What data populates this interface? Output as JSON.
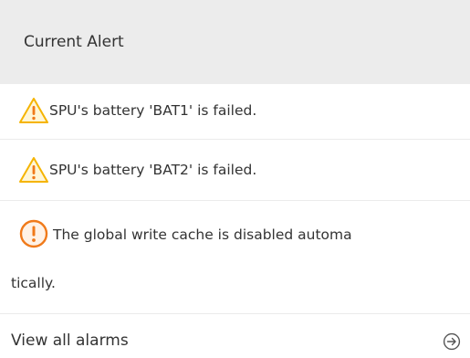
{
  "panel": {
    "title": "Current Alert"
  },
  "alerts": [
    {
      "severity": "warning",
      "icon": "warning-triangle-icon",
      "message": "SPU's battery 'BAT1' is failed."
    },
    {
      "severity": "warning",
      "icon": "warning-triangle-icon",
      "message": "SPU's battery 'BAT2' is failed."
    },
    {
      "severity": "major",
      "icon": "alert-circle-icon",
      "message_line1": "The global write cache is disabled automa",
      "message_line2": "tically."
    }
  ],
  "footer": {
    "link_label": "View all alarms",
    "arrow_icon": "arrow-right-circle-icon"
  },
  "colors": {
    "header_background": "#ececec",
    "warning": "#f5b400",
    "major": "#f07a1a",
    "text": "#333333",
    "divider": "#ebebeb"
  }
}
